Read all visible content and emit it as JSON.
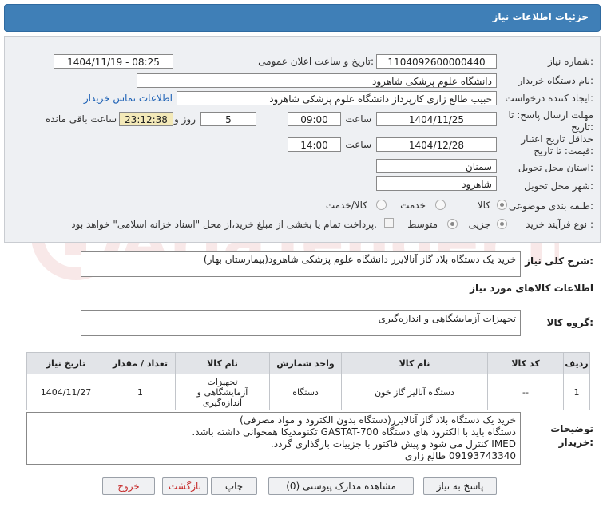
{
  "header": {
    "title": "جزئیات اطلاعات نیاز"
  },
  "form": {
    "need_number_label": "شماره نیاز:",
    "need_number": "1104092600000440",
    "announce_label": "تاریخ و ساعت اعلان عمومی:",
    "announce_value": "1404/11/19 - 08:25",
    "buyer_org_label": "نام دستگاه خریدار:",
    "buyer_org": "دانشگاه علوم پزشکی شاهرود",
    "creator_label": "ایجاد کننده درخواست:",
    "creator": "حبیب طالع زاری کارپرداز دانشگاه علوم پزشکی شاهرود",
    "contact_link": "اطلاعات تماس خریدار",
    "deadline_label_1": "مهلت ارسال پاسخ: تا",
    "deadline_label_2": "تاریخ:",
    "deadline_date": "1404/11/25",
    "time_word": "ساعت",
    "deadline_time": "09:00",
    "days_value": "5",
    "days_label": "روز و",
    "remaining_time": "23:12:38",
    "remaining_label": "ساعت باقی مانده",
    "validity_label_1": "حداقل تاریخ اعتبار",
    "validity_label_2": "قیمت: تا تاریخ:",
    "validity_date": "1404/12/28",
    "validity_time": "14:00",
    "province_label": "استان محل تحویل:",
    "province": "سمنان",
    "city_label": "شهر محل تحویل:",
    "city": "شاهرود",
    "category_label": "طبقه بندی موضوعی:",
    "category_options": [
      "کالا",
      "خدمت",
      "کالا/خدمت"
    ],
    "category_selected": "کالا",
    "process_label": "نوع فرآیند خرید :",
    "process_options": [
      "جزیی",
      "متوسط"
    ],
    "process_selected": "جزیی",
    "payment_text": "پرداخت تمام یا بخشی از مبلغ خرید،از محل \"اسناد خزانه اسلامی\" خواهد بود."
  },
  "summary": {
    "label": "شرح کلی نیاز:",
    "text": "خرید یک دستگاه بلاد گاز آنالایزر دانشگاه علوم پزشکی شاهرود(بیمارستان بهار)"
  },
  "goods": {
    "section_title": "اطلاعات کالاهای مورد نیاز",
    "group_label": "گروه کالا:",
    "group_value": "تجهیزات آزمایشگاهی و اندازه‌گیری",
    "columns": [
      "ردیف",
      "کد کالا",
      "نام کالا",
      "واحد شمارش",
      "نام کالا",
      "تعداد / مقدار",
      "تاریخ نیاز"
    ],
    "rows": [
      {
        "row": "1",
        "code": "--",
        "name": "دستگاه آنالیز گاز خون",
        "unit": "دستگاه",
        "group": "تجهیزات آزمایشگاهی و اندازه‌گیری",
        "qty": "1",
        "date": "1404/11/27"
      }
    ]
  },
  "notes": {
    "label_1": "توضیحات",
    "label_2": "خریدار:",
    "lines": [
      "خرید یک دستگاه بلاد گاز آنالایزر(دستگاه بدون الکترود و مواد مصرفی)",
      "دستگاه باید با الکترود های دستگاه GASTAT-700 تکنومدیکا همخوانی داشته باشد.",
      "IMED کنترل می شود و پیش فاکتور با جزییات بارگذاری گردد.",
      "09193743340 طالع زاری"
    ]
  },
  "buttons": {
    "reply": "پاسخ به نیاز",
    "docs": "مشاهده مدارک پیوستی (0)",
    "print": "چاپ",
    "back": "بازگشت",
    "exit": "خروج"
  },
  "watermark": {
    "text": "AriaTender.net"
  },
  "colors": {
    "header_bg": "#3f7fb7",
    "panel_bg": "#eef0f3",
    "remaining_bg": "#f3e9b8",
    "link": "#1a5fb4",
    "exit": "#c62828"
  }
}
